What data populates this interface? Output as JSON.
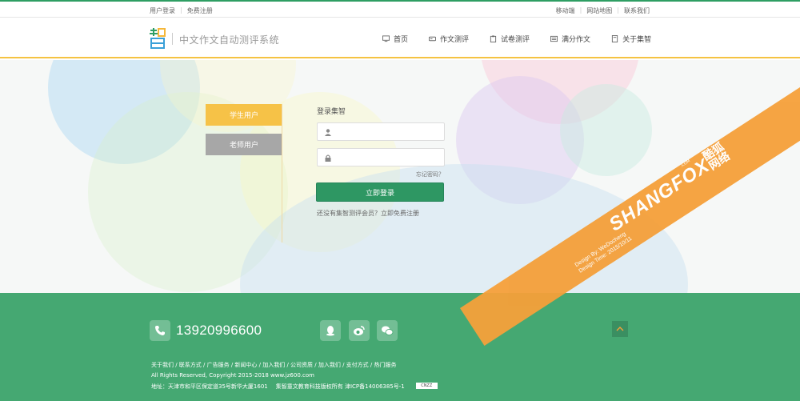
{
  "topbar": {
    "login": "用户登录",
    "register": "免费注册",
    "mobile": "移动端",
    "sitemap": "网站地图",
    "contact": "联系我们"
  },
  "header": {
    "logo_char": "智",
    "site_title": "中文作文自动测评系统",
    "nav": [
      {
        "label": "首页",
        "icon": "monitor-icon"
      },
      {
        "label": "作文测评",
        "icon": "pencil-icon"
      },
      {
        "label": "试卷测评",
        "icon": "clipboard-icon"
      },
      {
        "label": "满分作文",
        "icon": "book-icon"
      },
      {
        "label": "关于集智",
        "icon": "info-icon"
      }
    ]
  },
  "login": {
    "tab_student": "学生用户",
    "tab_teacher": "老师用户",
    "title": "登录集智",
    "forgot": "忘记密码？",
    "submit": "立即登录",
    "register_prompt": "还没有集智测评会员？立即免费注册"
  },
  "footer": {
    "phone": "13920996600",
    "links": "关于我们 / 联系方式 / 广告服务 / 新闻中心 / 加入我们 / 公司资质 / 加入我们 / 支付方式 / 热门服务",
    "copyright": "All Rights Reserved, Copyright 2015-2018 www.jz600.com",
    "address": "地址：天津市和平区保定道35号新华大厦1601",
    "company": "集智童文教育科技版权所有 津ICP备14006385号-1",
    "cnzz": "CNZZ"
  },
  "watermark": {
    "brand": "SHANGFOX",
    "com": ".COM",
    "cn": "酷狐网络",
    "design_by": "Design By: WeDocheng",
    "design_time": "Design Time: 2015/10/11"
  },
  "colors": {
    "brand_green": "#2e9763",
    "footer_green": "#45a872",
    "accent_yellow": "#f6c247",
    "tab_gray": "#a7a7a7",
    "ribbon_orange": "#f5a03a"
  }
}
